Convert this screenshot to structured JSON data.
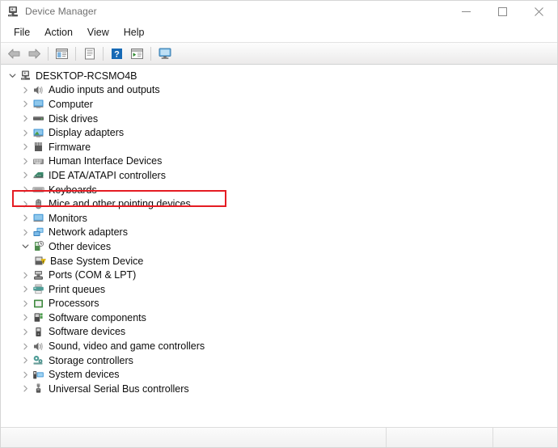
{
  "window": {
    "title": "Device Manager",
    "icon": "device-manager-icon"
  },
  "caption": {
    "minimize_label": "Minimize",
    "maximize_label": "Maximize",
    "close_label": "Close"
  },
  "menubar": {
    "items": [
      {
        "label": "File"
      },
      {
        "label": "Action"
      },
      {
        "label": "View"
      },
      {
        "label": "Help"
      }
    ]
  },
  "toolbar": {
    "buttons": [
      {
        "name": "back-arrow-icon",
        "tooltip": "Back"
      },
      {
        "name": "forward-arrow-icon",
        "tooltip": "Forward"
      },
      {
        "name": "show-hide-console-tree-icon",
        "tooltip": "Show/Hide Console Tree"
      },
      {
        "name": "properties-icon",
        "tooltip": "Properties"
      },
      {
        "name": "help-icon",
        "tooltip": "Help"
      },
      {
        "name": "scan-for-hardware-changes-icon",
        "tooltip": "Scan for hardware changes"
      },
      {
        "name": "update-driver-icon",
        "tooltip": "Update driver"
      }
    ]
  },
  "tree": {
    "root": {
      "label": "DESKTOP-RCSMO4B",
      "icon": "computer-root-icon",
      "expanded": true
    },
    "nodes": [
      {
        "label": "Audio inputs and outputs",
        "icon": "speaker-icon",
        "expanded": false,
        "level": 1
      },
      {
        "label": "Computer",
        "icon": "computer-icon",
        "expanded": false,
        "level": 1
      },
      {
        "label": "Disk drives",
        "icon": "disk-drive-icon",
        "expanded": false,
        "level": 1
      },
      {
        "label": "Display adapters",
        "icon": "display-adapter-icon",
        "expanded": false,
        "level": 1
      },
      {
        "label": "Firmware",
        "icon": "firmware-icon",
        "expanded": false,
        "level": 1
      },
      {
        "label": "Human Interface Devices",
        "icon": "hid-icon",
        "expanded": false,
        "level": 1
      },
      {
        "label": "IDE ATA/ATAPI controllers",
        "icon": "ide-controller-icon",
        "expanded": false,
        "level": 1
      },
      {
        "label": "Keyboards",
        "icon": "keyboard-icon",
        "expanded": false,
        "level": 1
      },
      {
        "label": "Mice and other pointing devices",
        "icon": "mouse-icon",
        "expanded": false,
        "level": 1,
        "highlighted": true
      },
      {
        "label": "Monitors",
        "icon": "monitor-icon",
        "expanded": false,
        "level": 1
      },
      {
        "label": "Network adapters",
        "icon": "network-adapter-icon",
        "expanded": false,
        "level": 1
      },
      {
        "label": "Other devices",
        "icon": "other-devices-icon",
        "expanded": true,
        "level": 1
      },
      {
        "label": "Base System Device",
        "icon": "unknown-device-warning-icon",
        "expanded": null,
        "level": 2
      },
      {
        "label": "Ports (COM & LPT)",
        "icon": "port-icon",
        "expanded": false,
        "level": 1
      },
      {
        "label": "Print queues",
        "icon": "printer-icon",
        "expanded": false,
        "level": 1
      },
      {
        "label": "Processors",
        "icon": "processor-icon",
        "expanded": false,
        "level": 1
      },
      {
        "label": "Software components",
        "icon": "software-component-icon",
        "expanded": false,
        "level": 1
      },
      {
        "label": "Software devices",
        "icon": "software-device-icon",
        "expanded": false,
        "level": 1
      },
      {
        "label": "Sound, video and game controllers",
        "icon": "sound-controller-icon",
        "expanded": false,
        "level": 1
      },
      {
        "label": "Storage controllers",
        "icon": "storage-controller-icon",
        "expanded": false,
        "level": 1
      },
      {
        "label": "System devices",
        "icon": "system-device-icon",
        "expanded": false,
        "level": 1
      },
      {
        "label": "Universal Serial Bus controllers",
        "icon": "usb-controller-icon",
        "expanded": false,
        "level": 1
      }
    ]
  },
  "annotation": {
    "target_label": "Mice and other pointing devices",
    "color": "#e51c23"
  },
  "statusbar": {
    "panes": [
      "",
      "",
      ""
    ]
  }
}
